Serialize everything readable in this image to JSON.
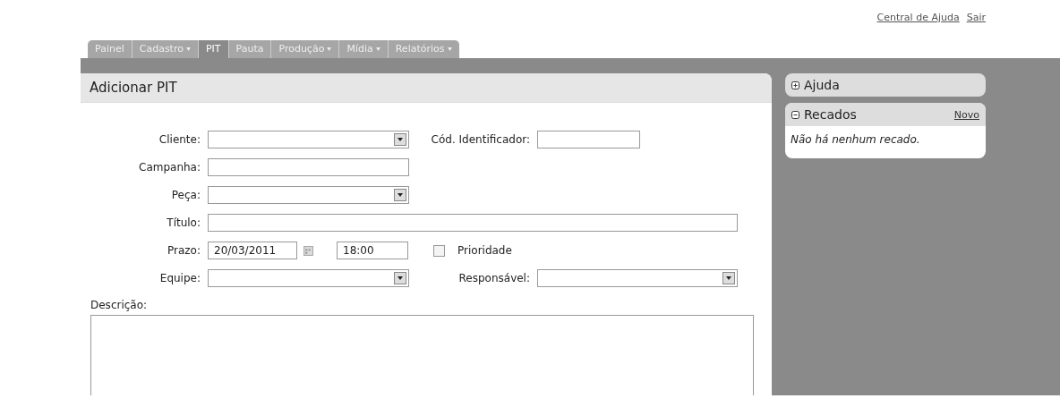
{
  "top_links": [
    "Central de Ajuda",
    "Sair"
  ],
  "tabs": [
    {
      "label": "Painel",
      "selected": false,
      "dropdown": false
    },
    {
      "label": "Cadastro",
      "selected": false,
      "dropdown": true
    },
    {
      "label": "PIT",
      "selected": true,
      "dropdown": false
    },
    {
      "label": "Pauta",
      "selected": false,
      "dropdown": false
    },
    {
      "label": "Produção",
      "selected": false,
      "dropdown": true
    },
    {
      "label": "Mídia",
      "selected": false,
      "dropdown": true
    },
    {
      "label": "Relatórios",
      "selected": false,
      "dropdown": true
    }
  ],
  "form": {
    "title": "Adicionar PIT",
    "rows": [
      {
        "label": "Cliente:",
        "kind": "select",
        "extra": {
          "label": "Cód. Identificador:",
          "kind": "text"
        }
      },
      {
        "label": "Campanha:",
        "kind": "text"
      },
      {
        "label": "Peça:",
        "kind": "select"
      },
      {
        "label": "Título:",
        "kind": "wide"
      },
      {
        "label": "Prazo:",
        "kind": "date",
        "value": "20/03/2011",
        "time": "18:00",
        "checkbox": {
          "label": "Prioridade",
          "checked": false
        }
      },
      {
        "label": "Equipe:",
        "kind": "select",
        "extra": {
          "label": "Responsável:",
          "kind": "select"
        }
      }
    ],
    "description_label": "Descrição:"
  },
  "sidebar": [
    {
      "title": "Ajuda",
      "expanded": false
    },
    {
      "title": "Recados",
      "expanded": true,
      "action": "Novo",
      "message": "Não há nenhum recado."
    }
  ]
}
